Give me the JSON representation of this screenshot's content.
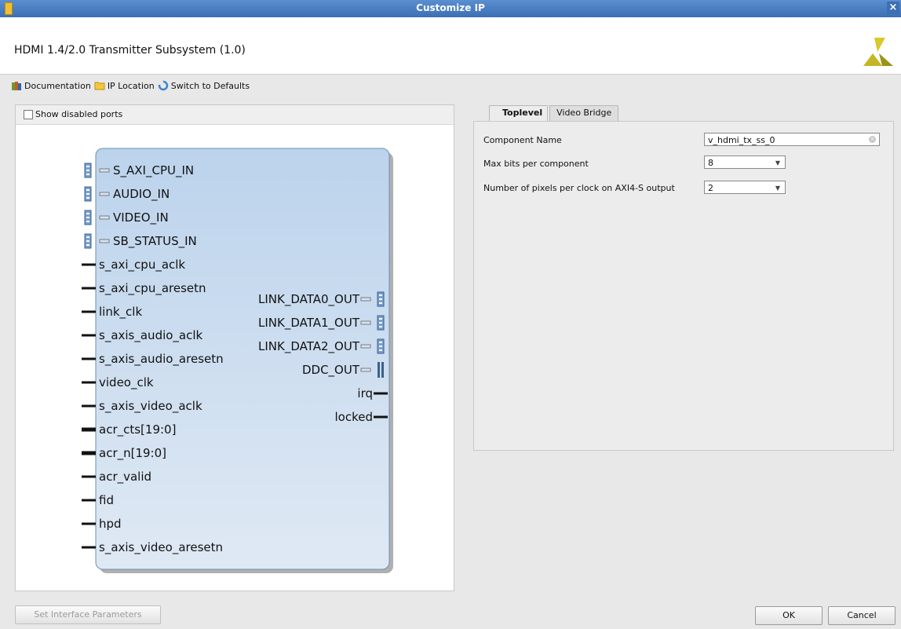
{
  "window": {
    "title": "Customize IP"
  },
  "header": {
    "ip_title": "HDMI 1.4/2.0 Transmitter Subsystem (1.0)"
  },
  "toolbar": {
    "documentation": "Documentation",
    "ip_location": "IP Location",
    "switch_defaults": "Switch to Defaults"
  },
  "left": {
    "show_disabled_ports": "Show disabled ports"
  },
  "block": {
    "left_ports": [
      {
        "label": "S_AXI_CPU_IN",
        "kind": "bus"
      },
      {
        "label": "AUDIO_IN",
        "kind": "bus"
      },
      {
        "label": "VIDEO_IN",
        "kind": "bus"
      },
      {
        "label": "SB_STATUS_IN",
        "kind": "bus"
      },
      {
        "label": "s_axi_cpu_aclk",
        "kind": "wire"
      },
      {
        "label": "s_axi_cpu_aresetn",
        "kind": "wire"
      },
      {
        "label": "link_clk",
        "kind": "wire"
      },
      {
        "label": "s_axis_audio_aclk",
        "kind": "wire"
      },
      {
        "label": "s_axis_audio_aresetn",
        "kind": "wire"
      },
      {
        "label": "video_clk",
        "kind": "wire"
      },
      {
        "label": "s_axis_video_aclk",
        "kind": "wire"
      },
      {
        "label": "acr_cts[19:0]",
        "kind": "vector"
      },
      {
        "label": "acr_n[19:0]",
        "kind": "vector"
      },
      {
        "label": "acr_valid",
        "kind": "wire"
      },
      {
        "label": "fid",
        "kind": "wire"
      },
      {
        "label": "hpd",
        "kind": "wire"
      },
      {
        "label": "s_axis_video_aresetn",
        "kind": "wire"
      }
    ],
    "right_ports": [
      {
        "label": "LINK_DATA0_OUT",
        "kind": "bus"
      },
      {
        "label": "LINK_DATA1_OUT",
        "kind": "bus"
      },
      {
        "label": "LINK_DATA2_OUT",
        "kind": "bus"
      },
      {
        "label": "DDC_OUT",
        "kind": "iic"
      },
      {
        "label": "irq",
        "kind": "wire"
      },
      {
        "label": "locked",
        "kind": "wire"
      }
    ]
  },
  "tabs": [
    {
      "label": "Toplevel",
      "active": true
    },
    {
      "label": "Video Bridge",
      "active": false
    }
  ],
  "params": {
    "component_name_label": "Component Name",
    "component_name_value": "v_hdmi_tx_ss_0",
    "max_bits_label": "Max bits per component",
    "max_bits_value": "8",
    "pixels_label": "Number of pixels per clock on AXI4-S output",
    "pixels_value": "2"
  },
  "buttons": {
    "set_interface": "Set Interface Parameters",
    "ok": "OK",
    "cancel": "Cancel"
  },
  "colors": {
    "accent": "#3c6eb4",
    "block_fill": "#c5d8ec",
    "block_border": "#6a8fb7"
  }
}
